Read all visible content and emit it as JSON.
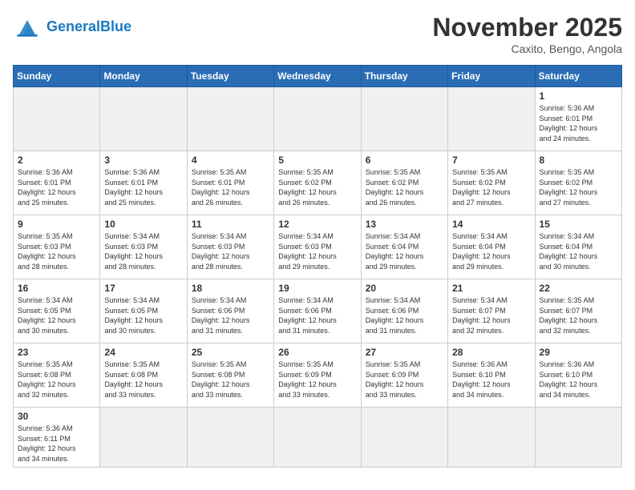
{
  "header": {
    "logo_line1": "General",
    "logo_line2": "Blue",
    "month": "November 2025",
    "location": "Caxito, Bengo, Angola"
  },
  "weekdays": [
    "Sunday",
    "Monday",
    "Tuesday",
    "Wednesday",
    "Thursday",
    "Friday",
    "Saturday"
  ],
  "days": [
    {
      "num": "",
      "info": "",
      "empty": true
    },
    {
      "num": "",
      "info": "",
      "empty": true
    },
    {
      "num": "",
      "info": "",
      "empty": true
    },
    {
      "num": "",
      "info": "",
      "empty": true
    },
    {
      "num": "",
      "info": "",
      "empty": true
    },
    {
      "num": "",
      "info": "",
      "empty": true
    },
    {
      "num": "1",
      "info": "Sunrise: 5:36 AM\nSunset: 6:01 PM\nDaylight: 12 hours\nand 24 minutes.",
      "empty": false
    },
    {
      "num": "2",
      "info": "Sunrise: 5:36 AM\nSunset: 6:01 PM\nDaylight: 12 hours\nand 25 minutes.",
      "empty": false
    },
    {
      "num": "3",
      "info": "Sunrise: 5:36 AM\nSunset: 6:01 PM\nDaylight: 12 hours\nand 25 minutes.",
      "empty": false
    },
    {
      "num": "4",
      "info": "Sunrise: 5:35 AM\nSunset: 6:01 PM\nDaylight: 12 hours\nand 26 minutes.",
      "empty": false
    },
    {
      "num": "5",
      "info": "Sunrise: 5:35 AM\nSunset: 6:02 PM\nDaylight: 12 hours\nand 26 minutes.",
      "empty": false
    },
    {
      "num": "6",
      "info": "Sunrise: 5:35 AM\nSunset: 6:02 PM\nDaylight: 12 hours\nand 26 minutes.",
      "empty": false
    },
    {
      "num": "7",
      "info": "Sunrise: 5:35 AM\nSunset: 6:02 PM\nDaylight: 12 hours\nand 27 minutes.",
      "empty": false
    },
    {
      "num": "8",
      "info": "Sunrise: 5:35 AM\nSunset: 6:02 PM\nDaylight: 12 hours\nand 27 minutes.",
      "empty": false
    },
    {
      "num": "9",
      "info": "Sunrise: 5:35 AM\nSunset: 6:03 PM\nDaylight: 12 hours\nand 28 minutes.",
      "empty": false
    },
    {
      "num": "10",
      "info": "Sunrise: 5:34 AM\nSunset: 6:03 PM\nDaylight: 12 hours\nand 28 minutes.",
      "empty": false
    },
    {
      "num": "11",
      "info": "Sunrise: 5:34 AM\nSunset: 6:03 PM\nDaylight: 12 hours\nand 28 minutes.",
      "empty": false
    },
    {
      "num": "12",
      "info": "Sunrise: 5:34 AM\nSunset: 6:03 PM\nDaylight: 12 hours\nand 29 minutes.",
      "empty": false
    },
    {
      "num": "13",
      "info": "Sunrise: 5:34 AM\nSunset: 6:04 PM\nDaylight: 12 hours\nand 29 minutes.",
      "empty": false
    },
    {
      "num": "14",
      "info": "Sunrise: 5:34 AM\nSunset: 6:04 PM\nDaylight: 12 hours\nand 29 minutes.",
      "empty": false
    },
    {
      "num": "15",
      "info": "Sunrise: 5:34 AM\nSunset: 6:04 PM\nDaylight: 12 hours\nand 30 minutes.",
      "empty": false
    },
    {
      "num": "16",
      "info": "Sunrise: 5:34 AM\nSunset: 6:05 PM\nDaylight: 12 hours\nand 30 minutes.",
      "empty": false
    },
    {
      "num": "17",
      "info": "Sunrise: 5:34 AM\nSunset: 6:05 PM\nDaylight: 12 hours\nand 30 minutes.",
      "empty": false
    },
    {
      "num": "18",
      "info": "Sunrise: 5:34 AM\nSunset: 6:06 PM\nDaylight: 12 hours\nand 31 minutes.",
      "empty": false
    },
    {
      "num": "19",
      "info": "Sunrise: 5:34 AM\nSunset: 6:06 PM\nDaylight: 12 hours\nand 31 minutes.",
      "empty": false
    },
    {
      "num": "20",
      "info": "Sunrise: 5:34 AM\nSunset: 6:06 PM\nDaylight: 12 hours\nand 31 minutes.",
      "empty": false
    },
    {
      "num": "21",
      "info": "Sunrise: 5:34 AM\nSunset: 6:07 PM\nDaylight: 12 hours\nand 32 minutes.",
      "empty": false
    },
    {
      "num": "22",
      "info": "Sunrise: 5:35 AM\nSunset: 6:07 PM\nDaylight: 12 hours\nand 32 minutes.",
      "empty": false
    },
    {
      "num": "23",
      "info": "Sunrise: 5:35 AM\nSunset: 6:08 PM\nDaylight: 12 hours\nand 32 minutes.",
      "empty": false
    },
    {
      "num": "24",
      "info": "Sunrise: 5:35 AM\nSunset: 6:08 PM\nDaylight: 12 hours\nand 33 minutes.",
      "empty": false
    },
    {
      "num": "25",
      "info": "Sunrise: 5:35 AM\nSunset: 6:08 PM\nDaylight: 12 hours\nand 33 minutes.",
      "empty": false
    },
    {
      "num": "26",
      "info": "Sunrise: 5:35 AM\nSunset: 6:09 PM\nDaylight: 12 hours\nand 33 minutes.",
      "empty": false
    },
    {
      "num": "27",
      "info": "Sunrise: 5:35 AM\nSunset: 6:09 PM\nDaylight: 12 hours\nand 33 minutes.",
      "empty": false
    },
    {
      "num": "28",
      "info": "Sunrise: 5:36 AM\nSunset: 6:10 PM\nDaylight: 12 hours\nand 34 minutes.",
      "empty": false
    },
    {
      "num": "29",
      "info": "Sunrise: 5:36 AM\nSunset: 6:10 PM\nDaylight: 12 hours\nand 34 minutes.",
      "empty": false
    },
    {
      "num": "30",
      "info": "Sunrise: 5:36 AM\nSunset: 6:11 PM\nDaylight: 12 hours\nand 34 minutes.",
      "empty": false
    },
    {
      "num": "",
      "info": "",
      "empty": true
    },
    {
      "num": "",
      "info": "",
      "empty": true
    },
    {
      "num": "",
      "info": "",
      "empty": true
    },
    {
      "num": "",
      "info": "",
      "empty": true
    },
    {
      "num": "",
      "info": "",
      "empty": true
    },
    {
      "num": "",
      "info": "",
      "empty": true
    }
  ]
}
